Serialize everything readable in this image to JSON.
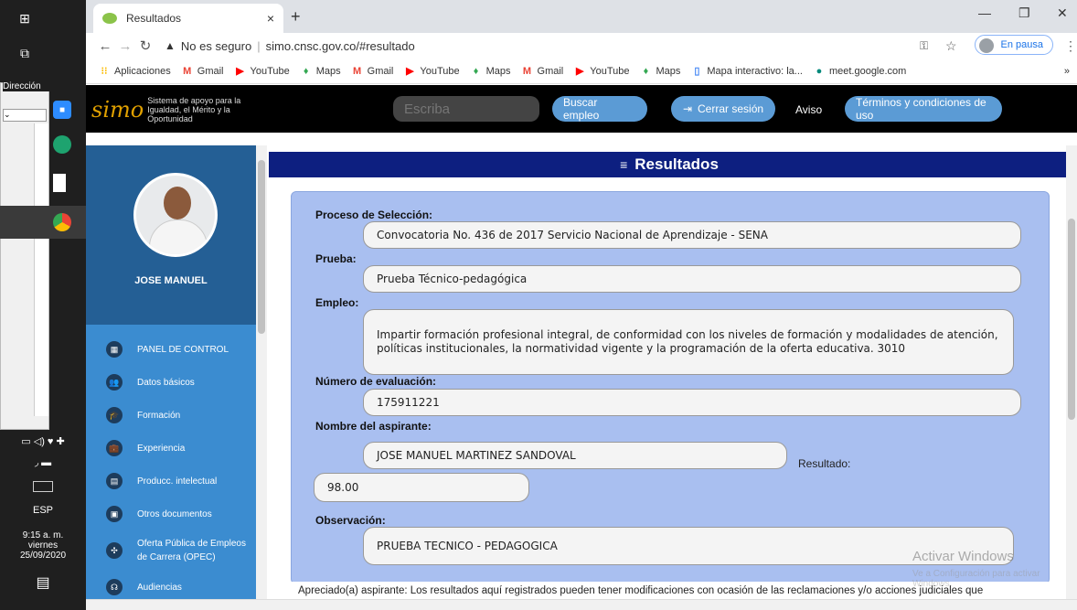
{
  "taskbar": {
    "address_label": "Dirección",
    "clock_time": "9:15 a. m.",
    "clock_day": "viernes",
    "clock_date": "25/09/2020",
    "language": "ESP"
  },
  "browser": {
    "tab_title": "Resultados",
    "security_label": "No es seguro",
    "url": "simo.cnsc.gov.co/#resultado",
    "profile_label": "En pausa",
    "bookmarks": [
      {
        "label": "Aplicaciones",
        "icon": "apps-grid-icon"
      },
      {
        "label": "Gmail",
        "icon": "gmail-icon"
      },
      {
        "label": "YouTube",
        "icon": "youtube-icon"
      },
      {
        "label": "Maps",
        "icon": "maps-icon"
      },
      {
        "label": "Gmail",
        "icon": "gmail-icon"
      },
      {
        "label": "YouTube",
        "icon": "youtube-icon"
      },
      {
        "label": "Maps",
        "icon": "maps-icon"
      },
      {
        "label": "Gmail",
        "icon": "gmail-icon"
      },
      {
        "label": "YouTube",
        "icon": "youtube-icon"
      },
      {
        "label": "Maps",
        "icon": "maps-icon"
      },
      {
        "label": "Mapa interactivo: la...",
        "icon": "bookmark-icon"
      },
      {
        "label": "meet.google.com",
        "icon": "meet-icon"
      }
    ]
  },
  "site": {
    "logo_text": "simo",
    "tagline": "Sistema de apoyo para la Igualdad, el Mérito y la Oportunidad",
    "search_placeholder": "Escriba",
    "search_button": "Buscar empleo",
    "logout_button": "Cerrar sesión",
    "notice_link": "Aviso",
    "terms_button": "Términos y condiciones de uso"
  },
  "sidebar": {
    "user_name": "JOSE MANUEL",
    "items": [
      {
        "label": "PANEL DE CONTROL",
        "icon": "dashboard-icon"
      },
      {
        "label": "Datos básicos",
        "icon": "people-icon"
      },
      {
        "label": "Formación",
        "icon": "graduate-icon"
      },
      {
        "label": "Experiencia",
        "icon": "briefcase-icon"
      },
      {
        "label": "Producc. intelectual",
        "icon": "book-icon"
      },
      {
        "label": "Otros documentos",
        "icon": "document-icon"
      },
      {
        "label": "Oferta Pública de Empleos de Carrera (OPEC)",
        "icon": "network-icon"
      },
      {
        "label": "Audiencias",
        "icon": "audience-icon"
      }
    ]
  },
  "results": {
    "header": "Resultados",
    "proceso_label": "Proceso de Selección:",
    "proceso_value": "Convocatoria No. 436 de 2017 Servicio Nacional de Aprendizaje - SENA",
    "prueba_label": "Prueba:",
    "prueba_value": "Prueba Técnico-pedagógica",
    "empleo_label": "Empleo:",
    "empleo_value": "Impartir formación profesional integral, de conformidad con los niveles de formación y modalidades de atención, políticas institucionales, la normatividad vigente y la programación de la oferta educativa. 3010",
    "evaluacion_label": "Número de evaluación:",
    "evaluacion_value": "175911221",
    "aspirante_label": "Nombre del aspirante:",
    "aspirante_value": "JOSE MANUEL MARTINEZ SANDOVAL",
    "resultado_label": "Resultado:",
    "resultado_value": "98.00",
    "observacion_label": "Observación:",
    "observacion_value": "PRUEBA TECNICO - PEDAGOGICA",
    "notice": "Apreciado(a) aspirante: Los resultados aquí registrados pueden tener modificaciones con ocasión de las reclamaciones y/o acciones judiciales que"
  },
  "watermark": {
    "line1": "Activar Windows",
    "line2": "Ve a Configuración para activar Windows."
  },
  "colors": {
    "results_header_bg": "#0d1f80",
    "card_bg": "#a9bff0",
    "sidebar_bg": "#3b8cd0",
    "header_button": "#5b9bd5"
  }
}
